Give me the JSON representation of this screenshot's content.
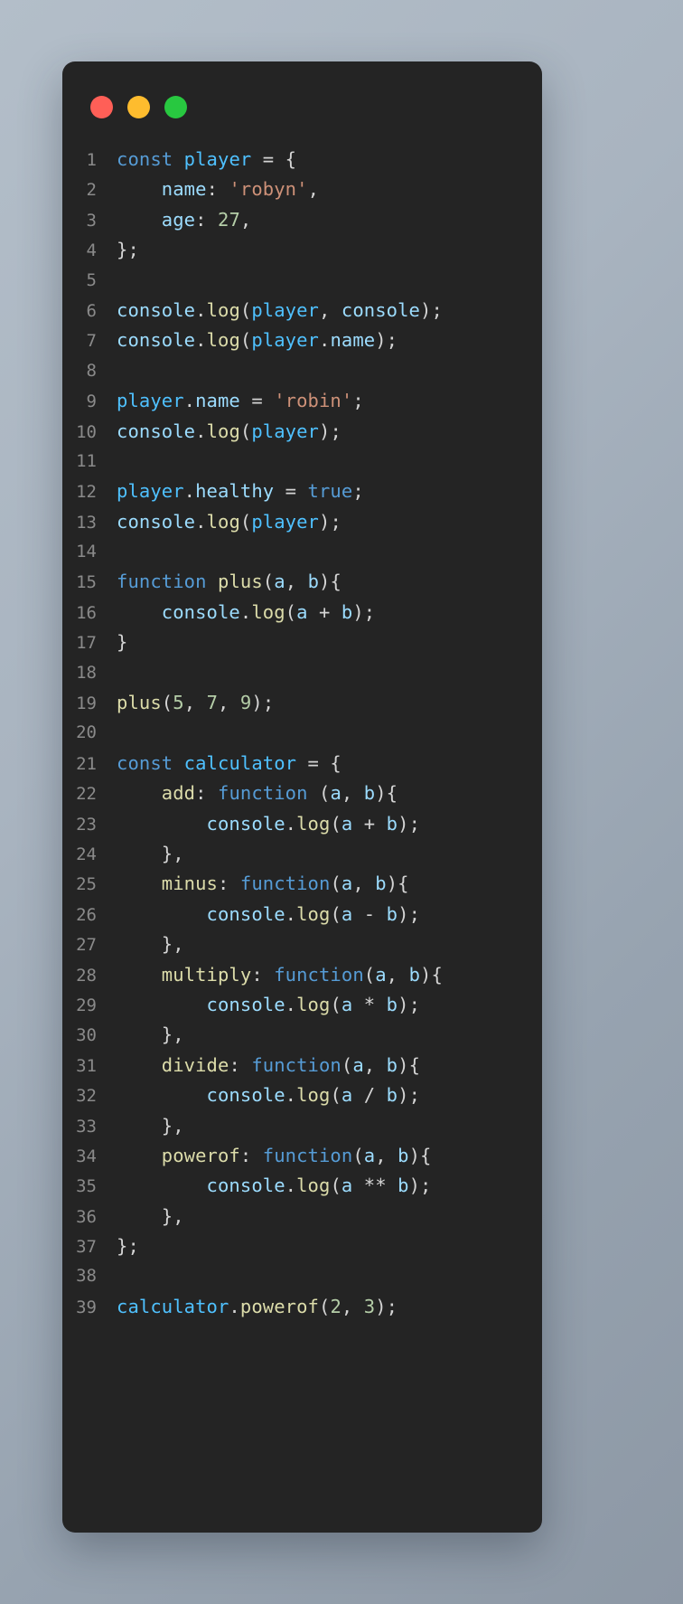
{
  "window": {
    "controls": [
      {
        "name": "close",
        "color": "#ff5f57"
      },
      {
        "name": "minimize",
        "color": "#febc2e"
      },
      {
        "name": "maximize",
        "color": "#28c840"
      }
    ]
  },
  "editor": {
    "language": "javascript",
    "theme_background": "#242424",
    "line_number_color": "#8a8a8a",
    "palette": {
      "keyword": "#569cd6",
      "variable": "#4fc1ff",
      "property": "#9cdcfe",
      "function": "#dcdcaa",
      "string": "#ce9178",
      "number": "#b5cea8",
      "plain": "#d4d4d4"
    },
    "lines": [
      {
        "n": "1",
        "text": "const player = {",
        "tokens": [
          {
            "t": "const",
            "c": "kw"
          },
          {
            "t": " ",
            "c": "pln"
          },
          {
            "t": "player",
            "c": "var"
          },
          {
            "t": " = {",
            "c": "pln"
          }
        ]
      },
      {
        "n": "2",
        "text": "    name: 'robyn',",
        "tokens": [
          {
            "t": "    ",
            "c": "pln"
          },
          {
            "t": "name",
            "c": "prop"
          },
          {
            "t": ": ",
            "c": "pln"
          },
          {
            "t": "'robyn'",
            "c": "str"
          },
          {
            "t": ",",
            "c": "pln"
          }
        ]
      },
      {
        "n": "3",
        "text": "    age: 27,",
        "tokens": [
          {
            "t": "    ",
            "c": "pln"
          },
          {
            "t": "age",
            "c": "prop"
          },
          {
            "t": ": ",
            "c": "pln"
          },
          {
            "t": "27",
            "c": "num"
          },
          {
            "t": ",",
            "c": "pln"
          }
        ]
      },
      {
        "n": "4",
        "text": "};",
        "tokens": [
          {
            "t": "};",
            "c": "pln"
          }
        ]
      },
      {
        "n": "5",
        "text": "",
        "tokens": []
      },
      {
        "n": "6",
        "text": "console.log(player, console);",
        "tokens": [
          {
            "t": "console",
            "c": "prop"
          },
          {
            "t": ".",
            "c": "pln"
          },
          {
            "t": "log",
            "c": "fn"
          },
          {
            "t": "(",
            "c": "pln"
          },
          {
            "t": "player",
            "c": "var"
          },
          {
            "t": ", ",
            "c": "pln"
          },
          {
            "t": "console",
            "c": "prop"
          },
          {
            "t": ");",
            "c": "pln"
          }
        ]
      },
      {
        "n": "7",
        "text": "console.log(player.name);",
        "tokens": [
          {
            "t": "console",
            "c": "prop"
          },
          {
            "t": ".",
            "c": "pln"
          },
          {
            "t": "log",
            "c": "fn"
          },
          {
            "t": "(",
            "c": "pln"
          },
          {
            "t": "player",
            "c": "var"
          },
          {
            "t": ".",
            "c": "pln"
          },
          {
            "t": "name",
            "c": "prop"
          },
          {
            "t": ");",
            "c": "pln"
          }
        ]
      },
      {
        "n": "8",
        "text": "",
        "tokens": []
      },
      {
        "n": "9",
        "text": "player.name = 'robin';",
        "tokens": [
          {
            "t": "player",
            "c": "var"
          },
          {
            "t": ".",
            "c": "pln"
          },
          {
            "t": "name",
            "c": "prop"
          },
          {
            "t": " = ",
            "c": "pln"
          },
          {
            "t": "'robin'",
            "c": "str"
          },
          {
            "t": ";",
            "c": "pln"
          }
        ]
      },
      {
        "n": "10",
        "text": "console.log(player);",
        "tokens": [
          {
            "t": "console",
            "c": "prop"
          },
          {
            "t": ".",
            "c": "pln"
          },
          {
            "t": "log",
            "c": "fn"
          },
          {
            "t": "(",
            "c": "pln"
          },
          {
            "t": "player",
            "c": "var"
          },
          {
            "t": ");",
            "c": "pln"
          }
        ]
      },
      {
        "n": "11",
        "text": "",
        "tokens": []
      },
      {
        "n": "12",
        "text": "player.healthy = true;",
        "tokens": [
          {
            "t": "player",
            "c": "var"
          },
          {
            "t": ".",
            "c": "pln"
          },
          {
            "t": "healthy",
            "c": "prop"
          },
          {
            "t": " = ",
            "c": "pln"
          },
          {
            "t": "true",
            "c": "kw"
          },
          {
            "t": ";",
            "c": "pln"
          }
        ]
      },
      {
        "n": "13",
        "text": "console.log(player);",
        "tokens": [
          {
            "t": "console",
            "c": "prop"
          },
          {
            "t": ".",
            "c": "pln"
          },
          {
            "t": "log",
            "c": "fn"
          },
          {
            "t": "(",
            "c": "pln"
          },
          {
            "t": "player",
            "c": "var"
          },
          {
            "t": ");",
            "c": "pln"
          }
        ]
      },
      {
        "n": "14",
        "text": "",
        "tokens": []
      },
      {
        "n": "15",
        "text": "function plus(a, b){",
        "tokens": [
          {
            "t": "function",
            "c": "kw"
          },
          {
            "t": " ",
            "c": "pln"
          },
          {
            "t": "plus",
            "c": "fn"
          },
          {
            "t": "(",
            "c": "pln"
          },
          {
            "t": "a",
            "c": "prop"
          },
          {
            "t": ", ",
            "c": "pln"
          },
          {
            "t": "b",
            "c": "prop"
          },
          {
            "t": "){",
            "c": "pln"
          }
        ]
      },
      {
        "n": "16",
        "text": "    console.log(a + b);",
        "tokens": [
          {
            "t": "    ",
            "c": "pln"
          },
          {
            "t": "console",
            "c": "prop"
          },
          {
            "t": ".",
            "c": "pln"
          },
          {
            "t": "log",
            "c": "fn"
          },
          {
            "t": "(",
            "c": "pln"
          },
          {
            "t": "a",
            "c": "prop"
          },
          {
            "t": " + ",
            "c": "pln"
          },
          {
            "t": "b",
            "c": "prop"
          },
          {
            "t": ");",
            "c": "pln"
          }
        ]
      },
      {
        "n": "17",
        "text": "}",
        "tokens": [
          {
            "t": "}",
            "c": "pln"
          }
        ]
      },
      {
        "n": "18",
        "text": "",
        "tokens": []
      },
      {
        "n": "19",
        "text": "plus(5, 7, 9);",
        "tokens": [
          {
            "t": "plus",
            "c": "fn"
          },
          {
            "t": "(",
            "c": "pln"
          },
          {
            "t": "5",
            "c": "num"
          },
          {
            "t": ", ",
            "c": "pln"
          },
          {
            "t": "7",
            "c": "num"
          },
          {
            "t": ", ",
            "c": "pln"
          },
          {
            "t": "9",
            "c": "num"
          },
          {
            "t": ");",
            "c": "pln"
          }
        ]
      },
      {
        "n": "20",
        "text": "",
        "tokens": []
      },
      {
        "n": "21",
        "text": "const calculator = {",
        "tokens": [
          {
            "t": "const",
            "c": "kw"
          },
          {
            "t": " ",
            "c": "pln"
          },
          {
            "t": "calculator",
            "c": "var"
          },
          {
            "t": " = {",
            "c": "pln"
          }
        ]
      },
      {
        "n": "22",
        "text": "    add: function (a, b){",
        "tokens": [
          {
            "t": "    ",
            "c": "pln"
          },
          {
            "t": "add",
            "c": "fn"
          },
          {
            "t": ": ",
            "c": "pln"
          },
          {
            "t": "function",
            "c": "kw"
          },
          {
            "t": " (",
            "c": "pln"
          },
          {
            "t": "a",
            "c": "prop"
          },
          {
            "t": ", ",
            "c": "pln"
          },
          {
            "t": "b",
            "c": "prop"
          },
          {
            "t": "){",
            "c": "pln"
          }
        ]
      },
      {
        "n": "23",
        "text": "        console.log(a + b);",
        "tokens": [
          {
            "t": "        ",
            "c": "pln"
          },
          {
            "t": "console",
            "c": "prop"
          },
          {
            "t": ".",
            "c": "pln"
          },
          {
            "t": "log",
            "c": "fn"
          },
          {
            "t": "(",
            "c": "pln"
          },
          {
            "t": "a",
            "c": "prop"
          },
          {
            "t": " + ",
            "c": "pln"
          },
          {
            "t": "b",
            "c": "prop"
          },
          {
            "t": ");",
            "c": "pln"
          }
        ]
      },
      {
        "n": "24",
        "text": "    },",
        "tokens": [
          {
            "t": "    },",
            "c": "pln"
          }
        ]
      },
      {
        "n": "25",
        "text": "    minus: function(a, b){",
        "tokens": [
          {
            "t": "    ",
            "c": "pln"
          },
          {
            "t": "minus",
            "c": "fn"
          },
          {
            "t": ": ",
            "c": "pln"
          },
          {
            "t": "function",
            "c": "kw"
          },
          {
            "t": "(",
            "c": "pln"
          },
          {
            "t": "a",
            "c": "prop"
          },
          {
            "t": ", ",
            "c": "pln"
          },
          {
            "t": "b",
            "c": "prop"
          },
          {
            "t": "){",
            "c": "pln"
          }
        ]
      },
      {
        "n": "26",
        "text": "        console.log(a - b);",
        "tokens": [
          {
            "t": "        ",
            "c": "pln"
          },
          {
            "t": "console",
            "c": "prop"
          },
          {
            "t": ".",
            "c": "pln"
          },
          {
            "t": "log",
            "c": "fn"
          },
          {
            "t": "(",
            "c": "pln"
          },
          {
            "t": "a",
            "c": "prop"
          },
          {
            "t": " - ",
            "c": "pln"
          },
          {
            "t": "b",
            "c": "prop"
          },
          {
            "t": ");",
            "c": "pln"
          }
        ]
      },
      {
        "n": "27",
        "text": "    },",
        "tokens": [
          {
            "t": "    },",
            "c": "pln"
          }
        ]
      },
      {
        "n": "28",
        "text": "    multiply: function(a, b){",
        "tokens": [
          {
            "t": "    ",
            "c": "pln"
          },
          {
            "t": "multiply",
            "c": "fn"
          },
          {
            "t": ": ",
            "c": "pln"
          },
          {
            "t": "function",
            "c": "kw"
          },
          {
            "t": "(",
            "c": "pln"
          },
          {
            "t": "a",
            "c": "prop"
          },
          {
            "t": ", ",
            "c": "pln"
          },
          {
            "t": "b",
            "c": "prop"
          },
          {
            "t": "){",
            "c": "pln"
          }
        ]
      },
      {
        "n": "29",
        "text": "        console.log(a * b);",
        "tokens": [
          {
            "t": "        ",
            "c": "pln"
          },
          {
            "t": "console",
            "c": "prop"
          },
          {
            "t": ".",
            "c": "pln"
          },
          {
            "t": "log",
            "c": "fn"
          },
          {
            "t": "(",
            "c": "pln"
          },
          {
            "t": "a",
            "c": "prop"
          },
          {
            "t": " * ",
            "c": "pln"
          },
          {
            "t": "b",
            "c": "prop"
          },
          {
            "t": ");",
            "c": "pln"
          }
        ]
      },
      {
        "n": "30",
        "text": "    },",
        "tokens": [
          {
            "t": "    },",
            "c": "pln"
          }
        ]
      },
      {
        "n": "31",
        "text": "    divide: function(a, b){",
        "tokens": [
          {
            "t": "    ",
            "c": "pln"
          },
          {
            "t": "divide",
            "c": "fn"
          },
          {
            "t": ": ",
            "c": "pln"
          },
          {
            "t": "function",
            "c": "kw"
          },
          {
            "t": "(",
            "c": "pln"
          },
          {
            "t": "a",
            "c": "prop"
          },
          {
            "t": ", ",
            "c": "pln"
          },
          {
            "t": "b",
            "c": "prop"
          },
          {
            "t": "){",
            "c": "pln"
          }
        ]
      },
      {
        "n": "32",
        "text": "        console.log(a / b);",
        "tokens": [
          {
            "t": "        ",
            "c": "pln"
          },
          {
            "t": "console",
            "c": "prop"
          },
          {
            "t": ".",
            "c": "pln"
          },
          {
            "t": "log",
            "c": "fn"
          },
          {
            "t": "(",
            "c": "pln"
          },
          {
            "t": "a",
            "c": "prop"
          },
          {
            "t": " / ",
            "c": "pln"
          },
          {
            "t": "b",
            "c": "prop"
          },
          {
            "t": ");",
            "c": "pln"
          }
        ]
      },
      {
        "n": "33",
        "text": "    },",
        "tokens": [
          {
            "t": "    },",
            "c": "pln"
          }
        ]
      },
      {
        "n": "34",
        "text": "    powerof: function(a, b){",
        "tokens": [
          {
            "t": "    ",
            "c": "pln"
          },
          {
            "t": "powerof",
            "c": "fn"
          },
          {
            "t": ": ",
            "c": "pln"
          },
          {
            "t": "function",
            "c": "kw"
          },
          {
            "t": "(",
            "c": "pln"
          },
          {
            "t": "a",
            "c": "prop"
          },
          {
            "t": ", ",
            "c": "pln"
          },
          {
            "t": "b",
            "c": "prop"
          },
          {
            "t": "){",
            "c": "pln"
          }
        ]
      },
      {
        "n": "35",
        "text": "        console.log(a ** b);",
        "tokens": [
          {
            "t": "        ",
            "c": "pln"
          },
          {
            "t": "console",
            "c": "prop"
          },
          {
            "t": ".",
            "c": "pln"
          },
          {
            "t": "log",
            "c": "fn"
          },
          {
            "t": "(",
            "c": "pln"
          },
          {
            "t": "a",
            "c": "prop"
          },
          {
            "t": " ** ",
            "c": "pln"
          },
          {
            "t": "b",
            "c": "prop"
          },
          {
            "t": ");",
            "c": "pln"
          }
        ]
      },
      {
        "n": "36",
        "text": "    },",
        "tokens": [
          {
            "t": "    },",
            "c": "pln"
          }
        ]
      },
      {
        "n": "37",
        "text": "};",
        "tokens": [
          {
            "t": "};",
            "c": "pln"
          }
        ]
      },
      {
        "n": "38",
        "text": "",
        "tokens": []
      },
      {
        "n": "39",
        "text": "calculator.powerof(2, 3);",
        "tokens": [
          {
            "t": "calculator",
            "c": "var"
          },
          {
            "t": ".",
            "c": "pln"
          },
          {
            "t": "powerof",
            "c": "fn"
          },
          {
            "t": "(",
            "c": "pln"
          },
          {
            "t": "2",
            "c": "num"
          },
          {
            "t": ", ",
            "c": "pln"
          },
          {
            "t": "3",
            "c": "num"
          },
          {
            "t": ");",
            "c": "pln"
          }
        ]
      }
    ]
  }
}
